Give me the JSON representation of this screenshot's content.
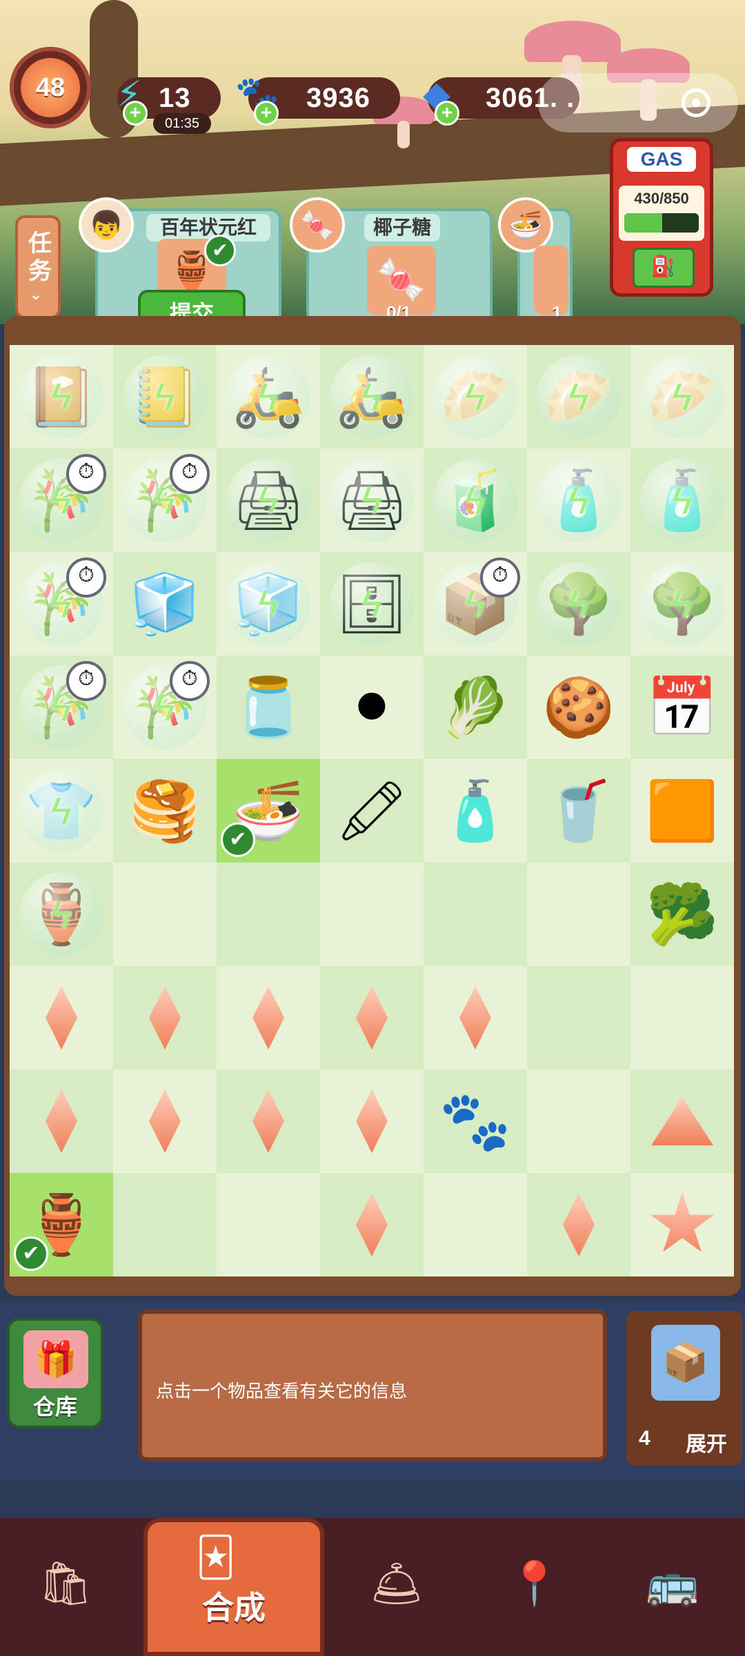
{
  "hud": {
    "level": "48",
    "energy": "13",
    "energy_timer": "01:35",
    "coins": "3936",
    "gems": "3061. .",
    "gas": "430/850",
    "gas_title": "GAS",
    "gas_fill_fraction": 0.506
  },
  "tasks": {
    "tab_label": "任务",
    "cards": [
      {
        "title": "百年状元红",
        "status": "done",
        "icon": "wine-jar-icon"
      },
      {
        "title": "椰子糖",
        "progress": "0/1",
        "icon": "coconut-candy-icon"
      },
      {
        "title": "",
        "progress": "1",
        "icon": "shrimp-noodle-icon"
      }
    ],
    "submit_label": "提交"
  },
  "board": {
    "rows": [
      [
        "notebook",
        "notebook-stack",
        "scooter-delivery",
        "scooter-box",
        "dumpling-steamer",
        "dumpling-steamer",
        "dumpling-steamer"
      ],
      [
        "bamboo-rolls-timer",
        "bamboo-rolls-timer",
        "printer",
        "printer",
        "bottle-crate",
        "bottle-shelf",
        "bottle-shelf"
      ],
      [
        "bamboo-rolls-timer",
        "sugar-cubes",
        "fridge",
        "safe-box",
        "hand-truck-timer",
        "bonsai-tree",
        "bonsai-tree"
      ],
      [
        "bamboo-rolls-timer",
        "bamboo-rolls-timer",
        "cream-jar",
        "tire",
        "vegetable-board",
        "meatball",
        "calendar"
      ],
      [
        "apron",
        "scallion-pancake",
        "shrimp-noodle-bowl",
        "ink-cartridges",
        "sauce-bottle",
        "purple-drink",
        "tofu-block"
      ],
      [
        "treasure-pot",
        "",
        "",
        "",
        "",
        "",
        "broccoli"
      ],
      [
        "gem",
        "gem",
        "gem",
        "gem",
        "gem",
        "",
        ""
      ],
      [
        "gem",
        "gem",
        "gem",
        "gem",
        "paw-coins",
        "",
        "triangle-gem"
      ],
      [
        "wine-jar",
        "",
        "",
        "gem",
        "",
        "gem",
        "star-gem"
      ]
    ]
  },
  "info": {
    "storage_label": "仓库",
    "message": "点击一个物品查看有关它的信息",
    "expand_count": "4",
    "expand_label": "展开"
  },
  "nav": {
    "active_label": "合成"
  }
}
